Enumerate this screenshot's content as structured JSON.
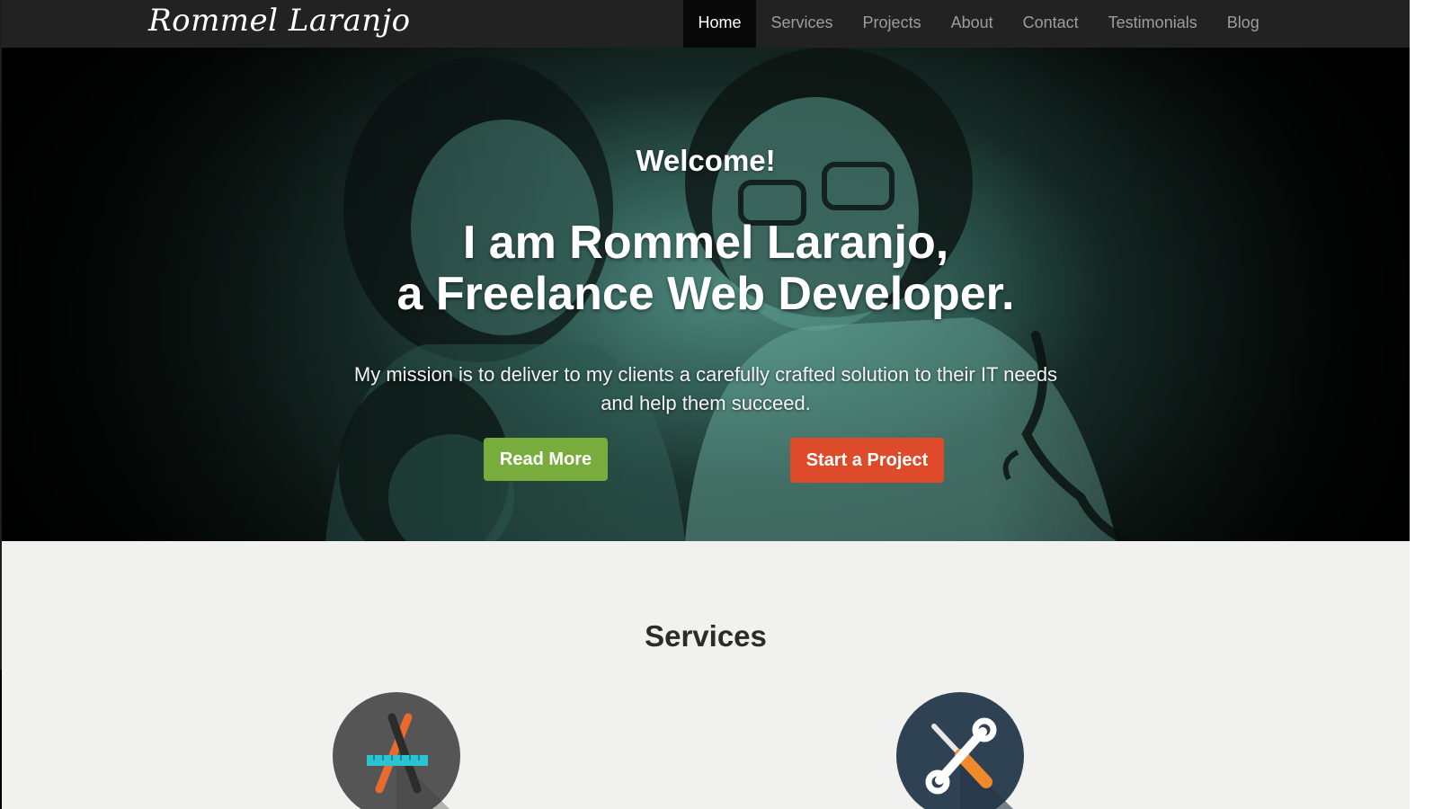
{
  "brand": "Rommel Laranjo",
  "nav": [
    {
      "label": "Home",
      "active": true
    },
    {
      "label": "Services",
      "active": false
    },
    {
      "label": "Projects",
      "active": false
    },
    {
      "label": "About",
      "active": false
    },
    {
      "label": "Contact",
      "active": false
    },
    {
      "label": "Testimonials",
      "active": false
    },
    {
      "label": "Blog",
      "active": false
    }
  ],
  "hero": {
    "welcome": "Welcome!",
    "headline_line1": "I am Rommel Laranjo,",
    "headline_line2": "a Freelance Web Developer.",
    "mission": "My mission is to deliver to my clients a carefully crafted solution to their IT needs and help them succeed.",
    "read_more": "Read More",
    "start_project": "Start a Project"
  },
  "services": {
    "title": "Services",
    "icons": [
      "design-tools-icon",
      "wrench-screwdriver-icon"
    ]
  },
  "colors": {
    "navbar": "#222222",
    "nav_active": "#080808",
    "read_more": "#78ad3d",
    "start_project": "#dd4b2b",
    "page_bg": "#f1f1ef"
  }
}
